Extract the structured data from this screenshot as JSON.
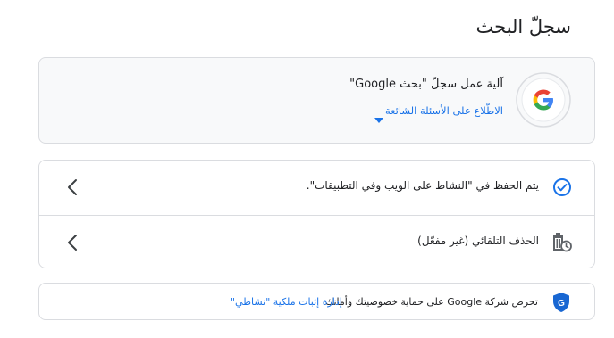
{
  "page": {
    "title": "سجلّ البحث"
  },
  "info_card": {
    "icon": "google-g-logo-icon",
    "title": "آلية عمل سجلّ \"بحث Google\"",
    "link": "الاطّلاع على الأسئلة الشائعة",
    "link_icon": "caret-down-icon"
  },
  "settings": {
    "items": [
      {
        "icon": "check-circle-icon",
        "label": "يتم الحفظ في \"النشاط على الويب وفي التطبيقات\".",
        "chevron": "chevron-left-icon"
      },
      {
        "icon": "auto-delete-icon",
        "label": "الحذف التلقائي (غير مفعّل)",
        "chevron": "chevron-left-icon"
      }
    ]
  },
  "privacy": {
    "icon": "shield-google-icon",
    "text": "تحرص شركة Google على حماية خصوصيتك وأمانك.",
    "link": "إدارة إثبات ملكية \"نشاطي\""
  },
  "colors": {
    "accent": "#1a73e8",
    "shield": "#1967d2",
    "icon_gray": "#5f6368",
    "border": "#dadce0",
    "info_bg": "#f8f9fa"
  }
}
